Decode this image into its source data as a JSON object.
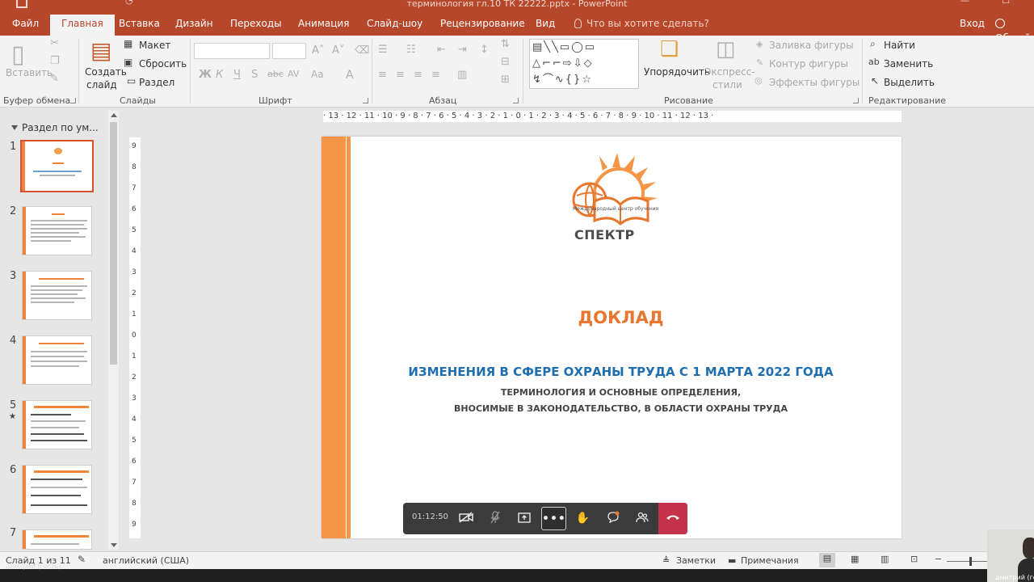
{
  "window": {
    "title": "терминология гл.10 ТК    22222.pptx - PowerPoint"
  },
  "tabs": [
    {
      "label": "Файл"
    },
    {
      "label": "Главная"
    },
    {
      "label": "Вставка"
    },
    {
      "label": "Дизайн"
    },
    {
      "label": "Переходы"
    },
    {
      "label": "Анимация"
    },
    {
      "label": "Слайд-шоу"
    },
    {
      "label": "Рецензирование"
    },
    {
      "label": "Вид"
    }
  ],
  "tell_me": "Что вы хотите сделать?",
  "account": {
    "signin": "Вход",
    "share": "Общий"
  },
  "ribbon": {
    "clipboard": {
      "paste": "Вставить",
      "group": "Буфер обмена"
    },
    "slides": {
      "new_slide_line1": "Создать",
      "new_slide_line2": "слайд",
      "layout": "Макет",
      "reset": "Сбросить",
      "section": "Раздел",
      "group": "Слайды"
    },
    "font": {
      "bold": "Ж",
      "italic": "К",
      "underline": "Ч",
      "shadow": "S",
      "strike": "abc",
      "spacing": "AV",
      "case": "Aa",
      "color": "A",
      "group": "Шрифт"
    },
    "paragraph": {
      "group": "Абзац"
    },
    "drawing": {
      "arrange": "Упорядочить",
      "styles_line1": "Экспресс-",
      "styles_line2": "стили",
      "fill": "Заливка фигуры",
      "outline": "Контур фигуры",
      "effects": "Эффекты фигуры",
      "group": "Рисование"
    },
    "editing": {
      "find": "Найти",
      "replace": "Заменить",
      "select": "Выделить",
      "group": "Редактирование"
    }
  },
  "slides_pane": {
    "section": "Раздел по ум...",
    "thumbnails": [
      {
        "num": "1"
      },
      {
        "num": "2"
      },
      {
        "num": "3"
      },
      {
        "num": "4"
      },
      {
        "num": "5"
      },
      {
        "num": "6"
      },
      {
        "num": "7"
      }
    ]
  },
  "ruler": {
    "h": "· 13 · 12 · 11 · 10 · 9 · 8 · 7 · 6 · 5 · 4 · 3 · 2 · 1 · 0 · 1 · 2 · 3 · 4 · 5 · 6 · 7 · 8 · 9 · 10 · 11 · 12 · 13 ·",
    "v": [
      "9",
      "8",
      "7",
      "6",
      "5",
      "4",
      "3",
      "2",
      "1",
      "0",
      "1",
      "2",
      "3",
      "4",
      "5",
      "6",
      "7",
      "8",
      "9"
    ]
  },
  "slide": {
    "logo_small": "Международный центр обучения",
    "logo_main": "СПЕКТР",
    "heading": "ДОКЛАД",
    "subtitle": "ИЗМЕНЕНИЯ В СФЕРЕ ОХРАНЫ ТРУДА С 1 МАРТА 2022 ГОДА",
    "line1": "ТЕРМИНОЛОГИЯ И ОСНОВНЫЕ ОПРЕДЕЛЕНИЯ,",
    "line2": "ВНОСИМЫЕ В ЗАКОНОДАТЕЛЬСТВО, В ОБЛАСТИ ОХРАНЫ ТРУДА"
  },
  "meeting": {
    "time": "01:12:50"
  },
  "status": {
    "slide": "Слайд 1 из 11",
    "language": "английский (США)",
    "notes": "Заметки",
    "comments": "Примечания"
  },
  "caption": {
    "left": "дмитрий (гость)",
    "tile": "дмитрий (го"
  },
  "colors": {
    "accent": "#b7472a",
    "slide_stripe": "#f59545",
    "heading": "#e8762e",
    "subtitle": "#1f6fb0",
    "hangup": "#c4314b"
  }
}
